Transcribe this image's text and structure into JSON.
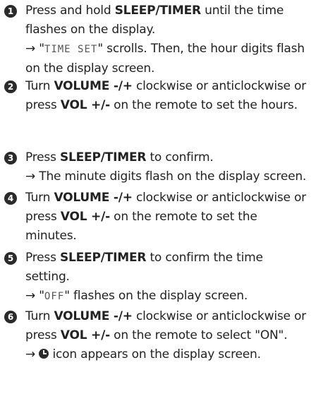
{
  "steps": [
    {
      "number": "1",
      "p1": "Press and hold ",
      "b1": "SLEEP/TIMER",
      "p2": " until the time flashes on the display.",
      "r_arrow": "→",
      "r_q1": "\"",
      "r_code": "TIME SET",
      "r_q2": "\"",
      "r_rest": " scrolls. Then, the hour digits flash on the display screen."
    },
    {
      "number": "2",
      "p1": "Turn ",
      "b1": "VOLUME -/+",
      "p2": " clockwise or anticlockwise or press ",
      "b2": "VOL +/-",
      "p3": " on the remote to set the hours."
    },
    {
      "number": "3",
      "p1": "Press ",
      "b1": "SLEEP/TIMER",
      "p2": " to confirm.",
      "r_arrow": "→",
      "r_rest": "The minute digits flash on the display screen."
    },
    {
      "number": "4",
      "p1": "Turn ",
      "b1": "VOLUME -/+",
      "p2": " clockwise or anticlockwise or press ",
      "b2": "VOL +/-",
      "p3": " on the remote to set the minutes."
    },
    {
      "number": "5",
      "p1": "Press ",
      "b1": "SLEEP/TIMER",
      "p2": " to confirm the time setting.",
      "r_arrow": "→",
      "r_q1": "\"",
      "r_code": "OFF",
      "r_q2": "\"",
      "r_rest": " flashes on the display screen."
    },
    {
      "number": "6",
      "p1": "Turn ",
      "b1": "VOLUME -/+",
      "p2": " clockwise or anticlockwise or press ",
      "b2": "VOL +/-",
      "p3": " on the remote to select \"ON\".",
      "r_arrow": "→",
      "r_icon": "clock-icon",
      "r_rest": " icon appears on the display screen."
    }
  ]
}
